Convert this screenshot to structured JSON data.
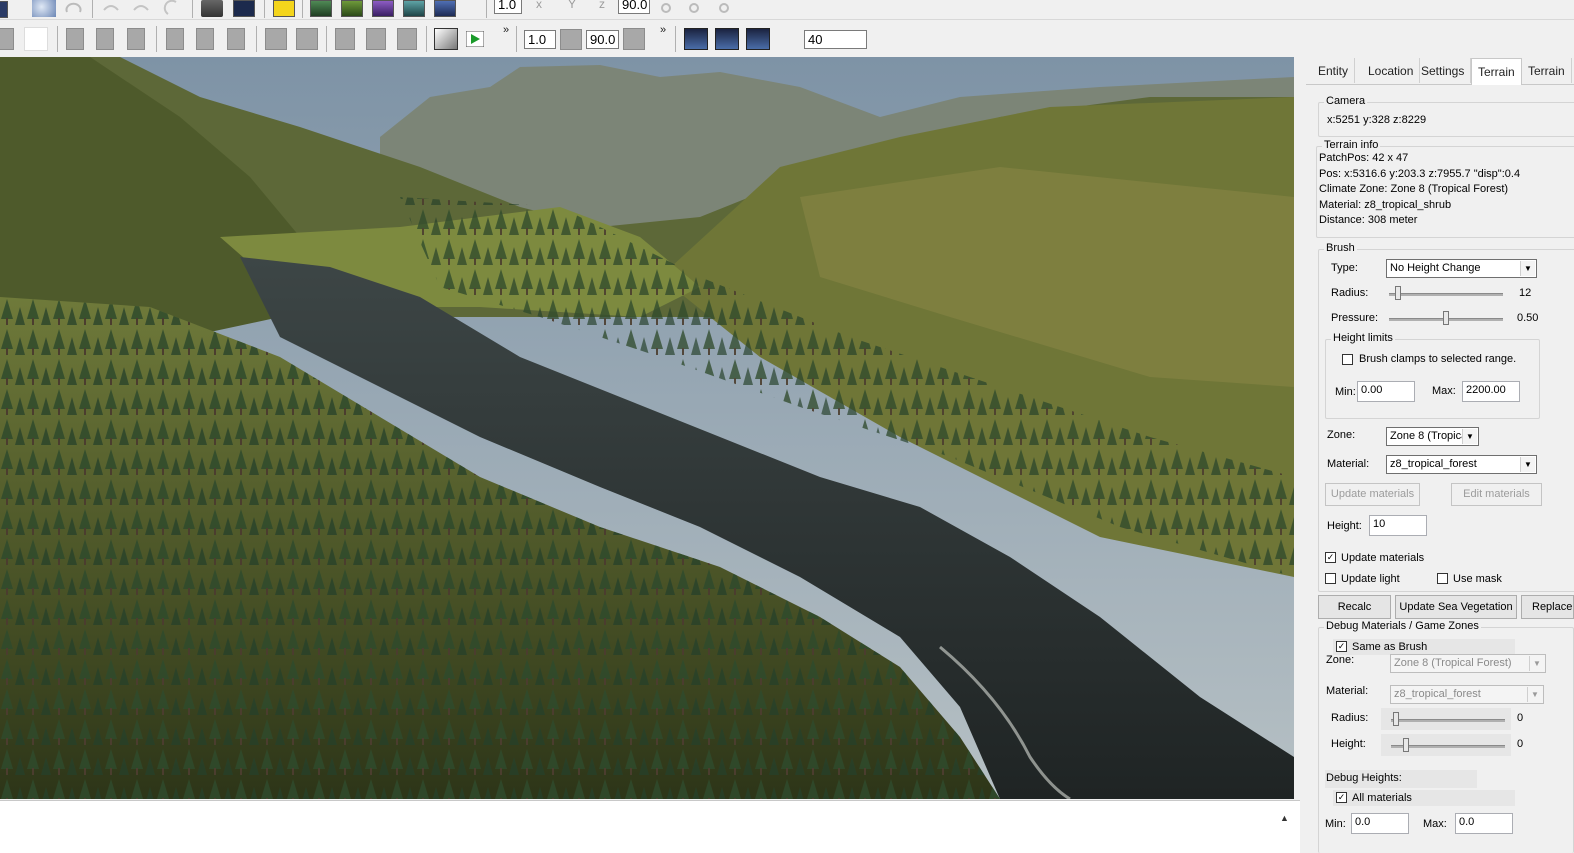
{
  "toolbar1": {
    "scale_value": "1.0",
    "x_label": "x",
    "y_label": "Y",
    "z_label": "z",
    "angle_value": "90.0"
  },
  "toolbar2": {
    "scale_value": "1.0",
    "angle_value": "90.0",
    "more_glyph": "»",
    "number_value": "40"
  },
  "tabs": [
    "Entity",
    "Location",
    "Settings",
    "Terrain",
    "Terrain"
  ],
  "camera": {
    "group_label": "Camera",
    "coords": "x:5251 y:328 z:8229"
  },
  "terrain_info": {
    "group_label": "Terrain info",
    "patch_pos": "PatchPos:  42 x 47",
    "pos": "Pos:   x:5316.6   y:203.3   z:7955.7   \"disp\":0.4",
    "climate_zone": "Climate Zone: Zone 8 (Tropical Forest)",
    "material": "Material: z8_tropical_shrub",
    "distance": "Distance: 308 meter"
  },
  "brush": {
    "group_label": "Brush",
    "type_label": "Type:",
    "type_value": "No Height Change",
    "radius_label": "Radius:",
    "radius_value": "12",
    "radius_level": 0.08,
    "pressure_label": "Pressure:",
    "pressure_value": "0.50",
    "pressure_level": 0.5,
    "height_limits_label": "Height limits",
    "clamp_label": "Brush clamps to selected range.",
    "clamp_checked": false,
    "min_label": "Min:",
    "min_value": "0.00",
    "max_label": "Max:",
    "max_value": "2200.00",
    "zone_label": "Zone:",
    "zone_value": "Zone 8 (Tropica",
    "material_label": "Material:",
    "material_value": "z8_tropical_forest",
    "update_materials_button": "Update materials",
    "edit_materials_button": "Edit materials",
    "height_label": "Height:",
    "height_value": "10",
    "update_materials_check": "Update materials",
    "update_materials_checked": true,
    "update_light_check": "Update light",
    "update_light_checked": false,
    "use_mask_check": "Use mask",
    "use_mask_checked": false
  },
  "actions": {
    "recalc": "Recalc",
    "update_sea_vegetation": "Update Sea Vegetation",
    "replace": "Replace"
  },
  "debug": {
    "group_label": "Debug Materials / Game Zones",
    "same_as_brush": "Same as Brush",
    "same_as_brush_checked": true,
    "zone_label": "Zone:",
    "zone_value": "Zone 8 (Tropical Forest)",
    "material_label": "Material:",
    "material_value": "z8_tropical_forest",
    "radius_label": "Radius:",
    "radius_value": "0",
    "height_label": "Height:",
    "height_value": "0",
    "debug_heights_label": "Debug Heights:",
    "all_materials": "All materials",
    "all_materials_checked": true,
    "min_label": "Min:",
    "min_value": "0.0",
    "max_label": "Max:",
    "max_value": "0.0"
  },
  "colors": {
    "toolbar_bg": "#f0f0f0",
    "panel_bg": "#f0f0f0",
    "active_tab": "#ffffff",
    "sky": "#8fa0ad",
    "forest": "#3f4a1f",
    "water": "#2b3232"
  }
}
